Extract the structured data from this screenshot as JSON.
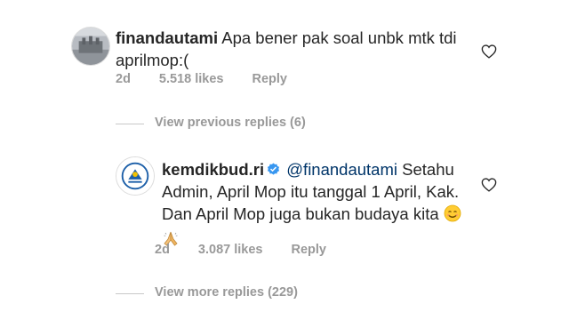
{
  "comment1": {
    "username": "finandautami",
    "text_line1": "Apa bener pak soal unbk mtk tdi",
    "text_line2": "aprilmop:(",
    "time": "2d",
    "likes": "5.518 likes",
    "reply_label": "Reply"
  },
  "previous_replies": {
    "label": "View previous replies (6)"
  },
  "comment2": {
    "username": "kemdikbud.ri",
    "mention": "@finandautami",
    "text_line1_rest": "Setahu",
    "text_line2": "Admin, April Mop itu tanggal 1 April, Kak.",
    "text_line3": "Dan April Mop juga bukan budaya kita",
    "time": "2d",
    "likes": "3.087 likes",
    "reply_label": "Reply"
  },
  "more_replies": {
    "label": "View more replies (229)"
  },
  "icons": {
    "heart": "heart-outline-icon",
    "verified": "verified-badge-icon",
    "smile_emoji": "smiling-face-emoji",
    "pray_emoji": "folded-hands-emoji"
  },
  "colors": {
    "text": "#262626",
    "meta": "#999999",
    "mention": "#003569",
    "verified": "#3897f0"
  }
}
